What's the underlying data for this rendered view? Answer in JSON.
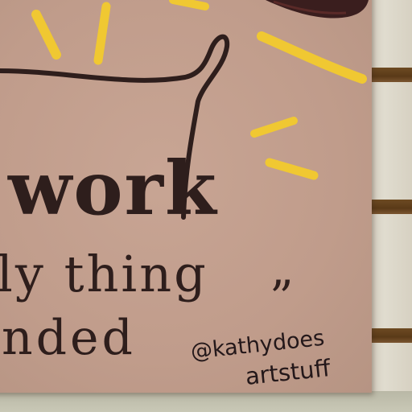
{
  "card": {
    "lines": [
      "work",
      "ly thing",
      "nded"
    ],
    "quote_mark": "”",
    "credit": {
      "handle": "@kathydoes",
      "suffix": "artstuff"
    }
  },
  "colors": {
    "card": "#c09c8b",
    "ink": "#2e1e1c",
    "accent_yellow": "#f0c832",
    "wall_slat": "#6d4a22",
    "wall": "#ddd8cb"
  }
}
